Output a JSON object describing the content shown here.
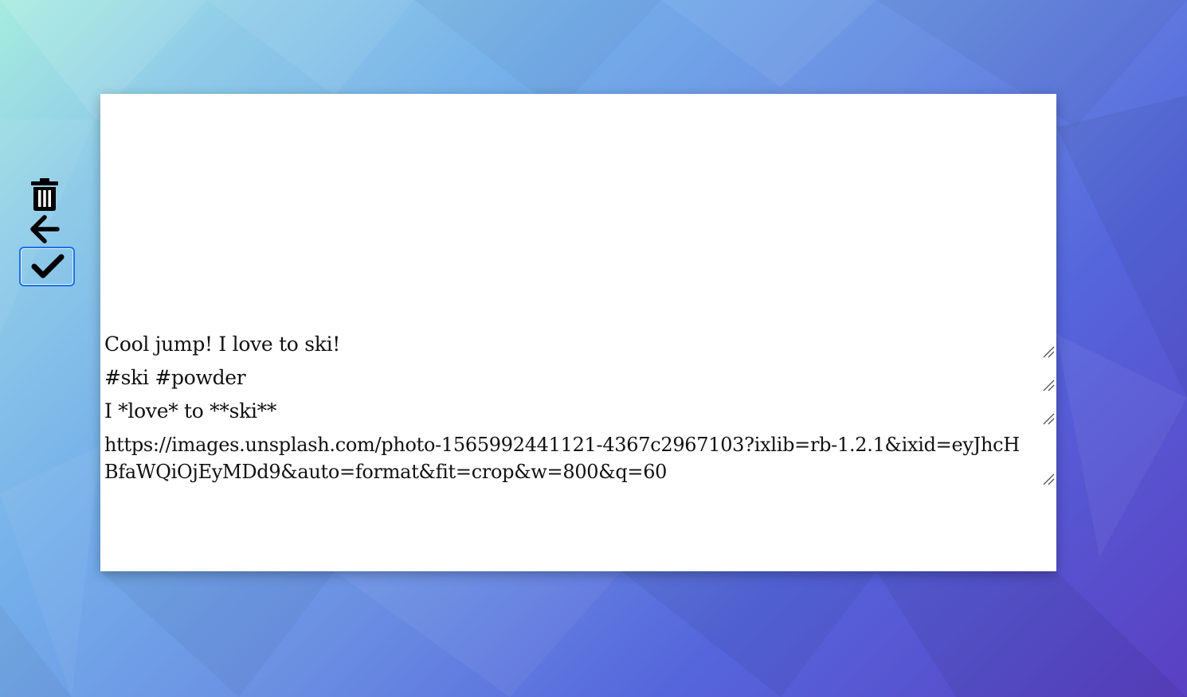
{
  "toolbar": {
    "delete_icon": "trash-icon",
    "back_icon": "arrow-left-icon",
    "confirm_icon": "check-icon",
    "accent_color": "#1a73e8"
  },
  "card": {
    "caption": "Cool jump! I love to ski!",
    "tags": "#ski #powder",
    "markdown": "I *love* to **ski**",
    "image_url": "https://images.unsplash.com/photo-1565992441121-4367c2967103?ixlib=rb-1.2.1&ixid=eyJhcHBfaWQiOjEyMDd9&auto=format&fit=crop&w=800&q=60"
  }
}
